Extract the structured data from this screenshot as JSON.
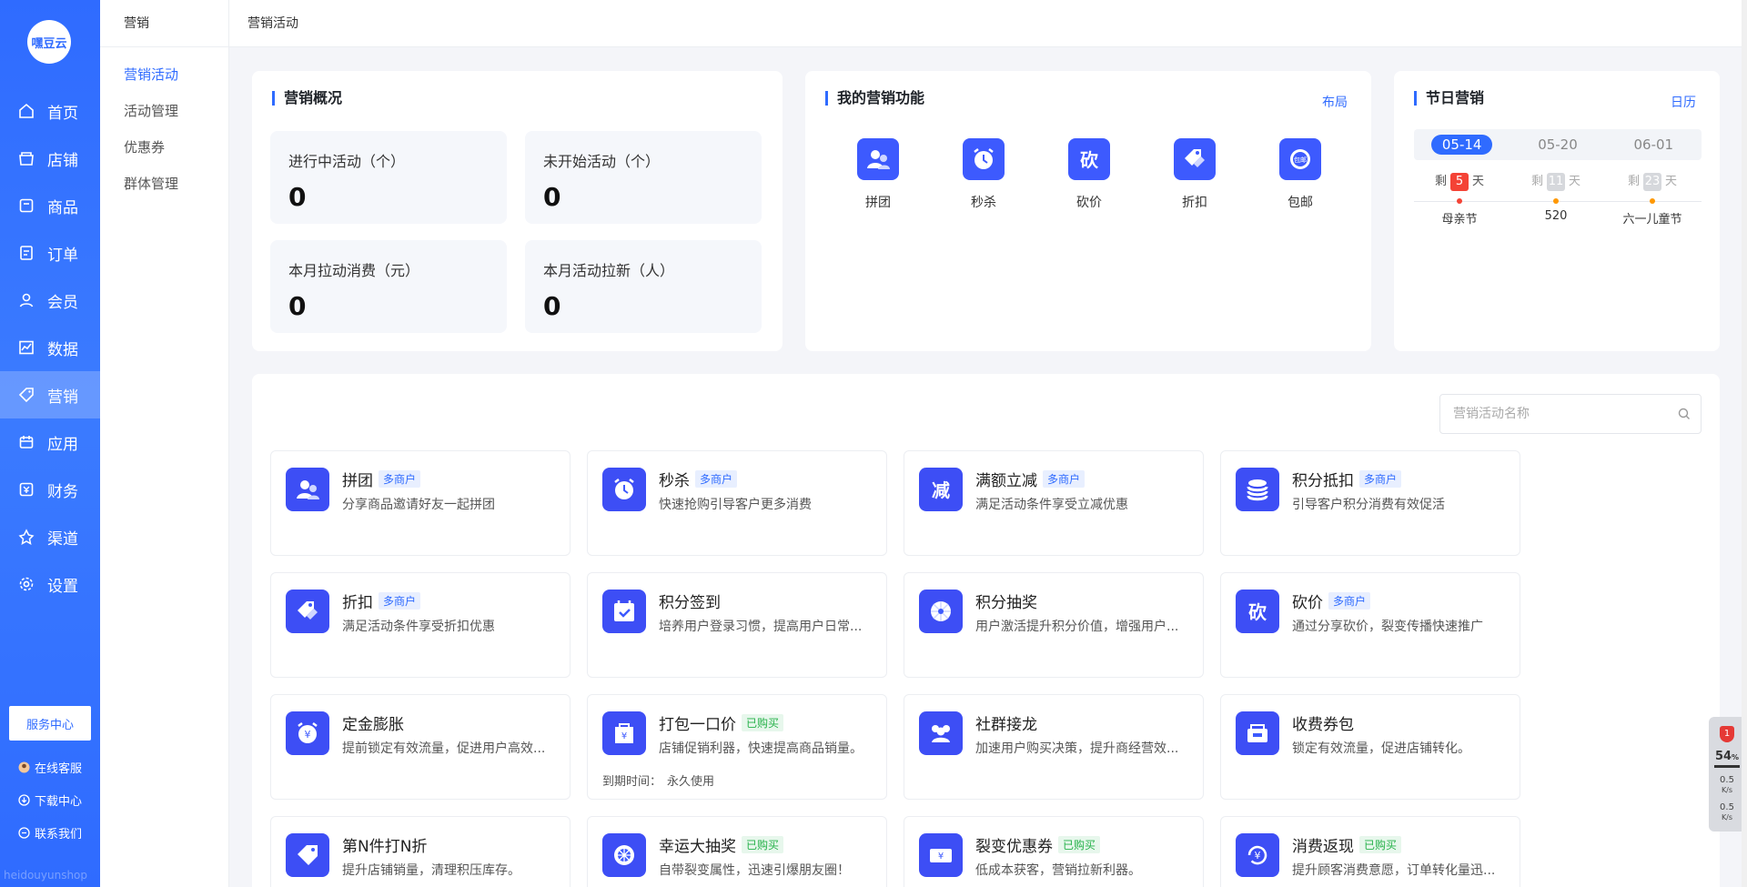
{
  "brand": {
    "logo_text": "嘿豆云",
    "watermark": "heidouyunshop"
  },
  "sidebar": {
    "items": [
      {
        "label": "首页",
        "icon": "home-icon"
      },
      {
        "label": "店铺",
        "icon": "store-icon"
      },
      {
        "label": "商品",
        "icon": "goods-icon"
      },
      {
        "label": "订单",
        "icon": "order-icon"
      },
      {
        "label": "会员",
        "icon": "member-icon"
      },
      {
        "label": "数据",
        "icon": "chart-icon"
      },
      {
        "label": "营销",
        "icon": "tag-icon",
        "active": true
      },
      {
        "label": "应用",
        "icon": "app-icon"
      },
      {
        "label": "财务",
        "icon": "finance-icon"
      },
      {
        "label": "渠道",
        "icon": "channel-icon"
      },
      {
        "label": "设置",
        "icon": "gear-icon"
      }
    ],
    "service_center": "服务中心",
    "online_service": "在线客服",
    "download_center": "下载中心",
    "contact_us": "联系我们"
  },
  "subnav": {
    "title": "营销",
    "items": [
      "营销活动",
      "活动管理",
      "优惠券",
      "群体管理"
    ]
  },
  "topbar": {
    "breadcrumb": "营销活动"
  },
  "overview": {
    "title": "营销概况",
    "stats": [
      {
        "label": "进行中活动（个）",
        "value": "0"
      },
      {
        "label": "未开始活动（个）",
        "value": "0"
      },
      {
        "label": "本月拉动消费（元）",
        "value": "0"
      },
      {
        "label": "本月活动拉新（人）",
        "value": "0"
      }
    ]
  },
  "my_functions": {
    "title": "我的营销功能",
    "layout_link": "布局",
    "items": [
      "拼团",
      "秒杀",
      "砍价",
      "折扣",
      "包邮"
    ]
  },
  "festival": {
    "title": "节日营销",
    "calendar_link": "日历",
    "dates": [
      "05-14",
      "05-20",
      "06-01"
    ],
    "prefix": "剩",
    "suffix": "天",
    "items": [
      {
        "days": "5",
        "name": "母亲节",
        "color": "#f44336"
      },
      {
        "days": "11",
        "name": "520",
        "color": "#d6d8dc"
      },
      {
        "days": "23",
        "name": "六一儿童节",
        "color": "#d6d8dc"
      }
    ]
  },
  "activities": {
    "search_placeholder": "营销活动名称",
    "expire_label": "到期时间：",
    "expire_value": "永久使用",
    "items": [
      {
        "title": "拼团",
        "badge": "多商户",
        "badge_type": "multi",
        "desc": "分享商品邀请好友一起拼团"
      },
      {
        "title": "秒杀",
        "badge": "多商户",
        "badge_type": "multi",
        "desc": "快速抢购引导客户更多消费"
      },
      {
        "title": "满额立减",
        "badge": "多商户",
        "badge_type": "multi",
        "desc": "满足活动条件享受立减优惠"
      },
      {
        "title": "积分抵扣",
        "badge": "多商户",
        "badge_type": "multi",
        "desc": "引导客户积分消费有效促活"
      },
      {
        "title": "折扣",
        "badge": "多商户",
        "badge_type": "multi",
        "desc": "满足活动条件享受折扣优惠"
      },
      {
        "title": "积分签到",
        "badge": "",
        "badge_type": "",
        "desc": "培养用户登录习惯，提高用户日常..."
      },
      {
        "title": "积分抽奖",
        "badge": "",
        "badge_type": "",
        "desc": "用户激活提升积分价值，增强用户..."
      },
      {
        "title": "砍价",
        "badge": "多商户",
        "badge_type": "multi",
        "desc": "通过分享砍价，裂变传播快速推广"
      },
      {
        "title": "定金膨胀",
        "badge": "",
        "badge_type": "",
        "desc": "提前锁定有效流量，促进用户高效..."
      },
      {
        "title": "打包一口价",
        "badge": "已购买",
        "badge_type": "bought",
        "desc": "店铺促销利器，快速提高商品销量。"
      },
      {
        "title": "社群接龙",
        "badge": "",
        "badge_type": "",
        "desc": "加速用户购买决策，提升商经营效..."
      },
      {
        "title": "收费券包",
        "badge": "",
        "badge_type": "",
        "desc": "锁定有效流量，促进店铺转化。"
      },
      {
        "title": "第N件打N折",
        "badge": "",
        "badge_type": "",
        "desc": "提升店铺销量，清理积压库存。"
      },
      {
        "title": "幸运大抽奖",
        "badge": "已购买",
        "badge_type": "bought",
        "desc": "自带裂变属性，迅速引爆朋友圈！"
      },
      {
        "title": "裂变优惠券",
        "badge": "已购买",
        "badge_type": "bought",
        "desc": "低成本获客，营销拉新利器。"
      },
      {
        "title": "消费返现",
        "badge": "已购买",
        "badge_type": "bought",
        "desc": "提升顾客消费意愿，订单转化量迅..."
      }
    ]
  },
  "float_widget": {
    "percent": "54",
    "percent_unit": "%",
    "up": "0.5",
    "down": "0.5",
    "unit": "K/s",
    "badge": "1"
  },
  "colors": {
    "accent": "#2f6bff",
    "icon_bg": "#3d4ef5",
    "bought": "#27b24a"
  }
}
